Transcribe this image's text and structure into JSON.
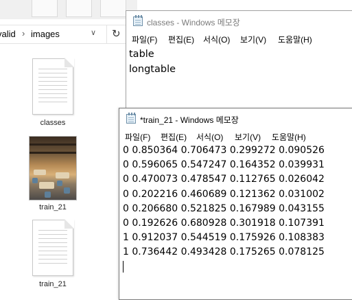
{
  "explorer": {
    "address": {
      "crumbs": [
        "valid",
        "images"
      ],
      "separator": "›",
      "dropdown_glyph": "∨",
      "refresh_glyph": "↻"
    },
    "files": [
      {
        "name": "classes",
        "type": "text-file-icon"
      },
      {
        "name": "train_21",
        "type": "image-thumbnail"
      },
      {
        "name": "train_21",
        "type": "text-file-icon"
      }
    ]
  },
  "notepad_classes": {
    "title": "classes - Windows 메모장",
    "menu": [
      "파일(F)",
      "편집(E)",
      "서식(O)",
      "보기(V)",
      "도움말(H)"
    ],
    "lines": [
      "table",
      "longtable"
    ]
  },
  "notepad_train": {
    "title": "*train_21 - Windows 메모장",
    "menu": [
      "파일(F)",
      "편집(E)",
      "서식(O)",
      "보기(V)",
      "도움말(H)"
    ],
    "lines": [
      "0 0.850364 0.706473 0.299272 0.090526",
      "0 0.596065 0.547247 0.164352 0.039931",
      "0 0.470073 0.478547 0.112765 0.026042",
      "0 0.202216 0.460689 0.121362 0.031002",
      "0 0.206680 0.521825 0.167989 0.043155",
      "0 0.192626 0.680928 0.301918 0.107391",
      "1 0.912037 0.544519 0.175926 0.108383",
      "1 0.736442 0.493428 0.175265 0.078125"
    ]
  },
  "colors": {
    "window_border": "#8e8e8e",
    "inactive_title": "#7a7a7a",
    "notepad_icon": "#6e8fa8"
  }
}
